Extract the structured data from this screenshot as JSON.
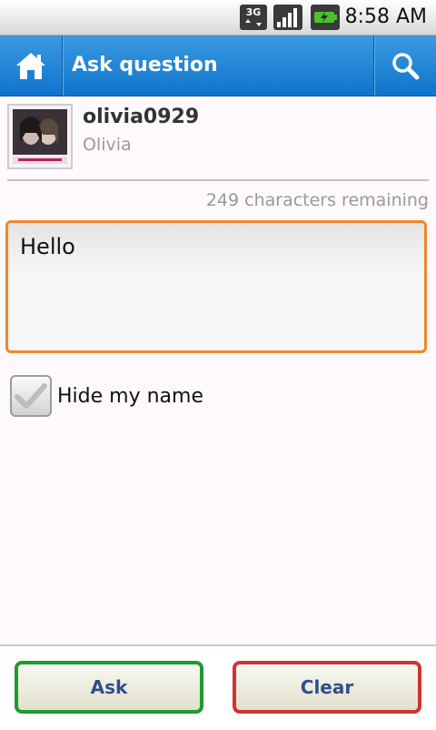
{
  "status_bar": {
    "network": "3G",
    "time": "8:58 AM",
    "icons": [
      "3g-data-icon",
      "signal-strength-icon",
      "battery-icon"
    ]
  },
  "title_bar": {
    "title": "Ask question",
    "icons": [
      "home-icon",
      "search-icon"
    ]
  },
  "profile": {
    "username": "olivia0929",
    "display_name": "Olivia"
  },
  "composer": {
    "chars_remaining": "249 characters remaining",
    "text_value": "Hello"
  },
  "options": {
    "hide_name_label": "Hide my name",
    "hide_name_checked": true
  },
  "actions": {
    "ask_label": "Ask",
    "clear_label": "Clear"
  },
  "colors": {
    "title_bar": "#1a82d6",
    "focus_border": "#f0872a",
    "ask_border": "#1e9a30",
    "clear_border": "#cc3434",
    "button_text": "#2e4f8c"
  }
}
